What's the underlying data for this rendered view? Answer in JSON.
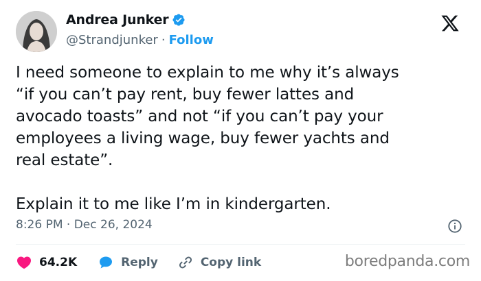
{
  "author": {
    "display_name": "Andrea Junker",
    "handle": "@Strandjunker",
    "separator": "·",
    "follow_label": "Follow",
    "verified": true
  },
  "tweet": {
    "paragraphs": [
      "I need someone to explain to me why it’s always\n“if you can’t pay rent, buy fewer lattes and\navocado toasts” and not “if you can’t pay your\nemployees a living wage, buy fewer yachts and\nreal estate”.",
      "Explain it to me like I’m in kindergarten."
    ],
    "timestamp": "8:26 PM · Dec 26, 2024"
  },
  "actions": {
    "like_count": "64.2K",
    "reply_label": "Reply",
    "copy_link_label": "Copy link"
  },
  "watermark": "boredpanda.com",
  "colors": {
    "accent": "#1d9bf0",
    "like": "#f91880",
    "text": "#0f1419",
    "muted": "#536471"
  },
  "icons": [
    "verified-badge-icon",
    "x-logo-icon",
    "info-icon",
    "heart-icon",
    "reply-bubble-icon",
    "link-icon"
  ]
}
